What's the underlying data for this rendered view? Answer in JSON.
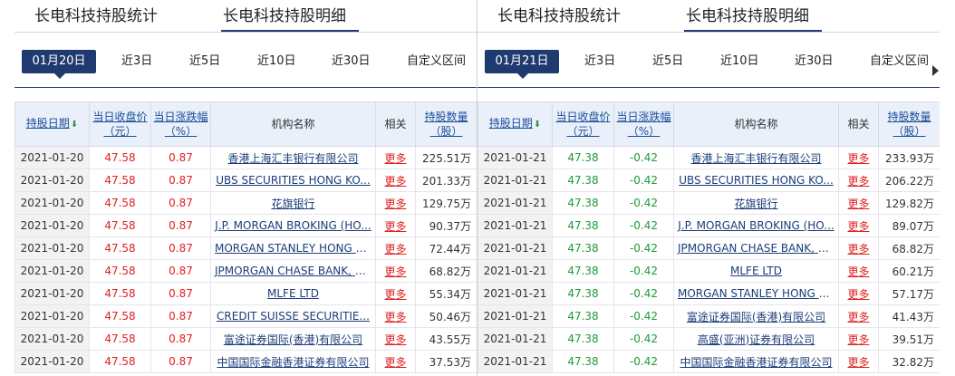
{
  "left": {
    "tabs": [
      "长电科技持股统计",
      "长电科技持股明细"
    ],
    "dates": [
      "01月20日",
      "近3日",
      "近5日",
      "近10日",
      "近30日",
      "自定义区间"
    ],
    "headers": {
      "date": "持股日期",
      "close": "当日收盘价",
      "close_unit": "（元）",
      "change": "当日涨跌幅",
      "change_unit": "（%）",
      "inst": "机构名称",
      "rel": "相关",
      "qty": "持股数量",
      "qty_unit": "（股）"
    },
    "rows": [
      {
        "date": "2021-01-20",
        "close": "47.58",
        "change": "0.87",
        "inst": "香港上海汇丰银行有限公司",
        "more": "更多",
        "qty": "225.51万"
      },
      {
        "date": "2021-01-20",
        "close": "47.58",
        "change": "0.87",
        "inst": "UBS SECURITIES HONG KO...",
        "more": "更多",
        "qty": "201.33万"
      },
      {
        "date": "2021-01-20",
        "close": "47.58",
        "change": "0.87",
        "inst": "花旗银行",
        "more": "更多",
        "qty": "129.75万"
      },
      {
        "date": "2021-01-20",
        "close": "47.58",
        "change": "0.87",
        "inst": "J.P. MORGAN BROKING (HO...",
        "more": "更多",
        "qty": "90.37万"
      },
      {
        "date": "2021-01-20",
        "close": "47.58",
        "change": "0.87",
        "inst": "MORGAN STANLEY HONG K...",
        "more": "更多",
        "qty": "72.44万"
      },
      {
        "date": "2021-01-20",
        "close": "47.58",
        "change": "0.87",
        "inst": "JPMORGAN CHASE BANK, N...",
        "more": "更多",
        "qty": "68.82万"
      },
      {
        "date": "2021-01-20",
        "close": "47.58",
        "change": "0.87",
        "inst": "MLFE LTD",
        "more": "更多",
        "qty": "55.34万"
      },
      {
        "date": "2021-01-20",
        "close": "47.58",
        "change": "0.87",
        "inst": "CREDIT SUISSE SECURITIE...",
        "more": "更多",
        "qty": "50.46万"
      },
      {
        "date": "2021-01-20",
        "close": "47.58",
        "change": "0.87",
        "inst": "富途证券国际(香港)有限公司",
        "more": "更多",
        "qty": "43.55万"
      },
      {
        "date": "2021-01-20",
        "close": "47.58",
        "change": "0.87",
        "inst": "中国国际金融香港证券有限公司",
        "more": "更多",
        "qty": "37.53万"
      }
    ]
  },
  "right": {
    "tabs": [
      "长电科技持股统计",
      "长电科技持股明细"
    ],
    "dates": [
      "01月21日",
      "近3日",
      "近5日",
      "近10日",
      "近30日",
      "自定义区间"
    ],
    "headers": {
      "date": "持股日期",
      "close": "当日收盘价",
      "close_unit": "（元）",
      "change": "当日涨跌幅",
      "change_unit": "（%）",
      "inst": "机构名称",
      "rel": "相关",
      "qty": "持股数量",
      "qty_unit": "（股）"
    },
    "rows": [
      {
        "date": "2021-01-21",
        "close": "47.38",
        "change": "-0.42",
        "inst": "香港上海汇丰银行有限公司",
        "more": "更多",
        "qty": "233.93万"
      },
      {
        "date": "2021-01-21",
        "close": "47.38",
        "change": "-0.42",
        "inst": "UBS SECURITIES HONG KO...",
        "more": "更多",
        "qty": "206.22万"
      },
      {
        "date": "2021-01-21",
        "close": "47.38",
        "change": "-0.42",
        "inst": "花旗银行",
        "more": "更多",
        "qty": "129.82万"
      },
      {
        "date": "2021-01-21",
        "close": "47.38",
        "change": "-0.42",
        "inst": "J.P. MORGAN BROKING (HO...",
        "more": "更多",
        "qty": "89.07万"
      },
      {
        "date": "2021-01-21",
        "close": "47.38",
        "change": "-0.42",
        "inst": "JPMORGAN CHASE BANK, N...",
        "more": "更多",
        "qty": "68.82万"
      },
      {
        "date": "2021-01-21",
        "close": "47.38",
        "change": "-0.42",
        "inst": "MLFE LTD",
        "more": "更多",
        "qty": "60.21万"
      },
      {
        "date": "2021-01-21",
        "close": "47.38",
        "change": "-0.42",
        "inst": "MORGAN STANLEY HONG K...",
        "more": "更多",
        "qty": "57.17万"
      },
      {
        "date": "2021-01-21",
        "close": "47.38",
        "change": "-0.42",
        "inst": "富途证券国际(香港)有限公司",
        "more": "更多",
        "qty": "41.43万"
      },
      {
        "date": "2021-01-21",
        "close": "47.38",
        "change": "-0.42",
        "inst": "高盛(亚洲)证券有限公司",
        "more": "更多",
        "qty": "39.51万"
      },
      {
        "date": "2021-01-21",
        "close": "47.38",
        "change": "-0.42",
        "inst": "中国国际金融香港证券有限公司",
        "more": "更多",
        "qty": "32.82万"
      }
    ]
  },
  "colors": {
    "accent": "#1f3a6e",
    "up": "#e02020",
    "down": "#1c9b3a",
    "header_bg": "#eaf0fa"
  }
}
